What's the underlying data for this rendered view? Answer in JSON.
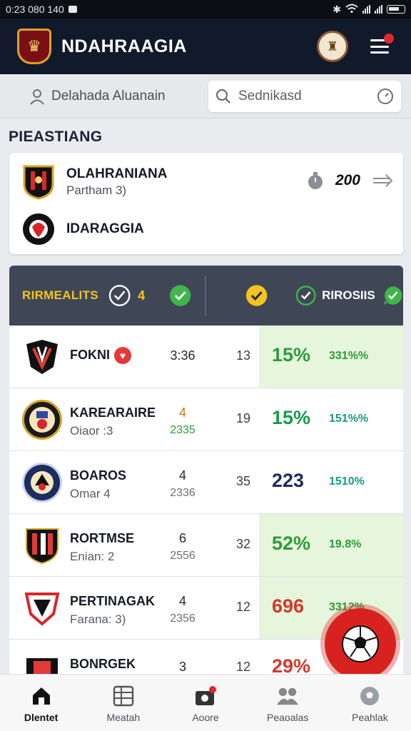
{
  "status_bar": {
    "time": "0:23 080 140"
  },
  "app_bar": {
    "title": "NDAHRAAGIA"
  },
  "search": {
    "user_label": "Delahada Aluanain",
    "placeholder": "Sednikasd"
  },
  "section": {
    "title": "PIEASTIANG"
  },
  "match_card": {
    "team1": {
      "name": "OLAHRANIANA",
      "sub": "Partham 3)"
    },
    "team2": {
      "name": "IDARAGGIA"
    },
    "score": "200"
  },
  "table_header": {
    "label": "RIRMEALITS",
    "count": "4",
    "label2": "RIROSIIS"
  },
  "rows": [
    {
      "name": "FOKNI",
      "sub": "",
      "c1": "3:36",
      "c1b": "",
      "c2": "13",
      "pct": "15%",
      "pct2": "331%%",
      "pct_color": "#2e9b3b",
      "pct2_color": "#2e9b3b",
      "green": true,
      "heart": true
    },
    {
      "name": "KAREARAIRE",
      "sub": "Oiaor :3",
      "c1": "4",
      "c1b": "2335",
      "c2": "19",
      "pct": "15%",
      "pct2": "151%%",
      "pct_color": "#1b9a4a",
      "pct2_color": "#1b9a84",
      "green": false,
      "heart": false
    },
    {
      "name": "BOAROS",
      "sub": "Omar 4",
      "c1": "4",
      "c1b": "2336",
      "c2": "35",
      "pct": "223",
      "pct2": "1510%",
      "pct_color": "#1d2c5e",
      "pct2_color": "#159d86",
      "green": false,
      "heart": false
    },
    {
      "name": "RORTMSE",
      "sub": "Enian: 2",
      "c1": "6",
      "c1b": "2556",
      "c2": "32",
      "pct": "52%",
      "pct2": "19.8%",
      "pct_color": "#2e9b3b",
      "pct2_color": "#2e9b3b",
      "green": true,
      "heart": false
    },
    {
      "name": "PERTINAGAK",
      "sub": "Farana: 3)",
      "c1": "4",
      "c1b": "2356",
      "c2": "12",
      "pct": "696",
      "pct2": "3312%",
      "pct_color": "#d6372b",
      "pct2_color": "#2e9b3b",
      "green": true,
      "heart": false
    },
    {
      "name": "BONRGEK",
      "sub": "",
      "c1": "3",
      "c1b": "",
      "c2": "12",
      "pct": "29%",
      "pct2": "",
      "pct_color": "#d6372b",
      "pct2_color": "#2e9b3b",
      "green": false,
      "heart": false
    }
  ],
  "bottom_nav": [
    {
      "label": "Dlentet",
      "icon": "home-icon"
    },
    {
      "label": "Meatah",
      "icon": "table-icon"
    },
    {
      "label": "Aoore",
      "icon": "camera-icon"
    },
    {
      "label": "Peaoalas",
      "icon": "team-icon"
    },
    {
      "label": "Peahlak",
      "icon": "ball-icon"
    }
  ]
}
